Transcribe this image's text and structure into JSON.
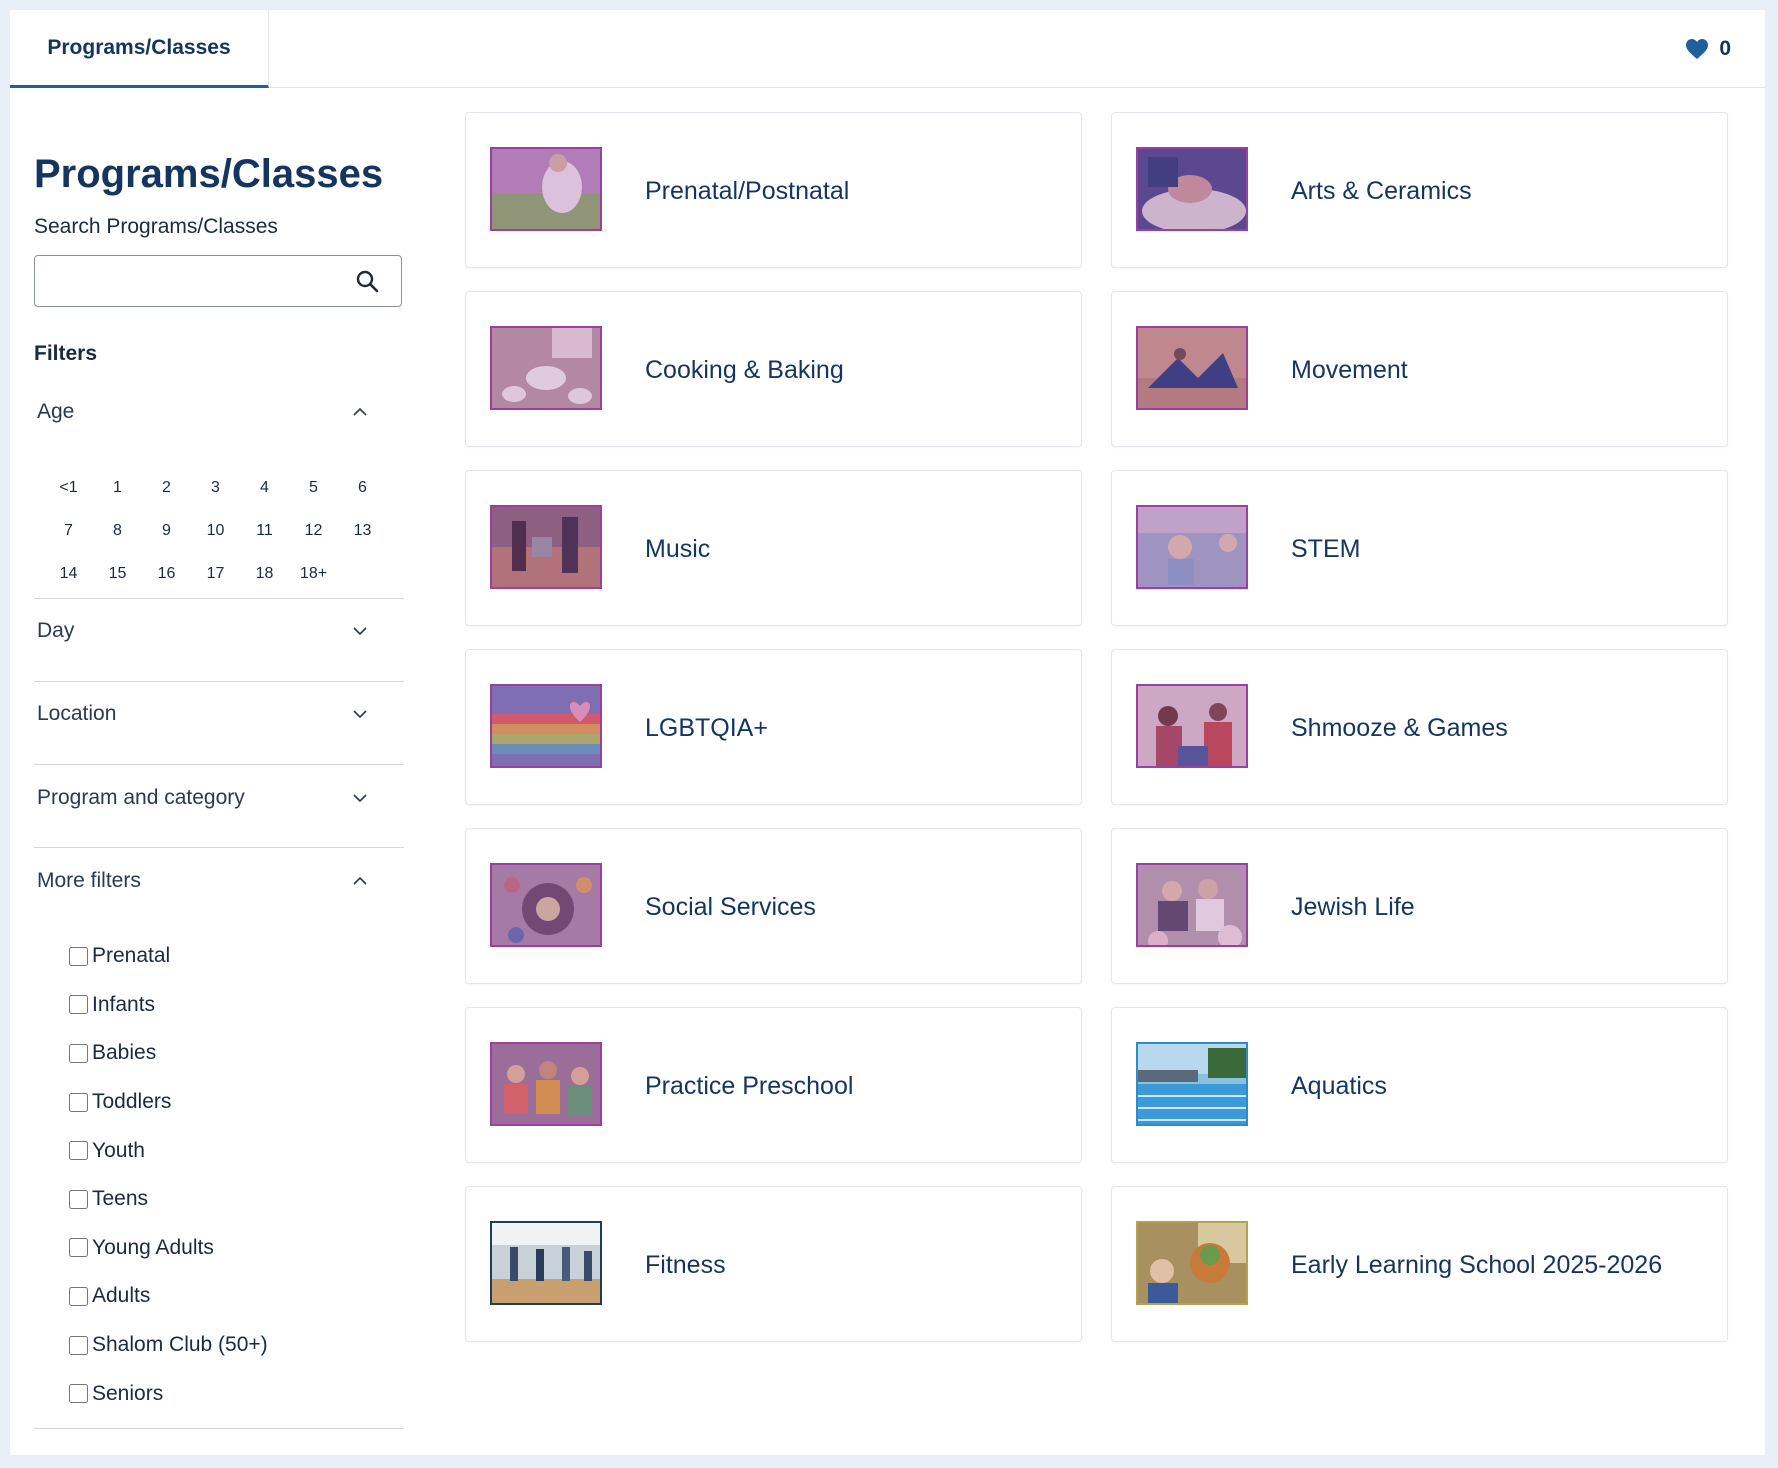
{
  "header": {
    "tab_label": "Programs/Classes",
    "favorites_count": "0"
  },
  "sidebar": {
    "title": "Programs/Classes",
    "search_label": "Search Programs/Classes",
    "search_value": "",
    "filters_title": "Filters",
    "sections": {
      "age": "Age",
      "day": "Day",
      "location": "Location",
      "program_category": "Program and category",
      "more_filters": "More filters"
    },
    "ages": [
      "<1",
      "1",
      "2",
      "3",
      "4",
      "5",
      "6",
      "7",
      "8",
      "9",
      "10",
      "11",
      "12",
      "13",
      "14",
      "15",
      "16",
      "17",
      "18",
      "18+"
    ],
    "more_filters": [
      "Prenatal",
      "Infants",
      "Babies",
      "Toddlers",
      "Youth",
      "Teens",
      "Young Adults",
      "Adults",
      "Shalom Club (50+)",
      "Seniors"
    ]
  },
  "cards": [
    {
      "label": "Prenatal/Postnatal",
      "image": "prenatal-photo"
    },
    {
      "label": "Arts & Ceramics",
      "image": "ceramics-photo"
    },
    {
      "label": "Cooking & Baking",
      "image": "cooking-photo"
    },
    {
      "label": "Movement",
      "image": "movement-photo"
    },
    {
      "label": "Music",
      "image": "music-photo"
    },
    {
      "label": "STEM",
      "image": "stem-photo"
    },
    {
      "label": "LGBTQIA+",
      "image": "lgbtqia-photo"
    },
    {
      "label": "Shmooze & Games",
      "image": "games-photo"
    },
    {
      "label": "Social Services",
      "image": "social-services-photo"
    },
    {
      "label": "Jewish Life",
      "image": "jewish-life-photo"
    },
    {
      "label": "Practice Preschool",
      "image": "preschool-photo"
    },
    {
      "label": "Aquatics",
      "image": "pool-photo"
    },
    {
      "label": "Fitness",
      "image": "fitness-photo"
    },
    {
      "label": "Early Learning School 2025-2026",
      "image": "early-learning-photo"
    }
  ],
  "colors": {
    "accent": "#1f5f9c",
    "title": "#14355f",
    "thumb_border": "#9b3fa0"
  }
}
